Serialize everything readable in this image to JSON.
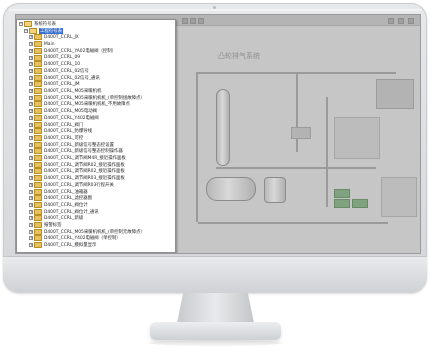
{
  "screen": {
    "background_app": {
      "diagram_title": "凸轮排气系统"
    },
    "tree": {
      "items": [
        {
          "label": "系统符号表",
          "level": 0,
          "expander": "−",
          "open": true
        },
        {
          "label": "工程符号表",
          "level": 1,
          "expander": "−",
          "open": true,
          "selected": true
        },
        {
          "label": "D400T_CCRL_JX",
          "level": 2,
          "expander": "+"
        },
        {
          "label": "Main",
          "level": 2,
          "expander": "+"
        },
        {
          "label": "D400T_CCRL_YA02电磁阀（控制）",
          "level": 2,
          "expander": "+"
        },
        {
          "label": "D400T_CCRL_09",
          "level": 2,
          "expander": "+"
        },
        {
          "label": "D400T_CCRL_10",
          "level": 2,
          "expander": "+"
        },
        {
          "label": "D400T_CCRL_02信号",
          "level": 2,
          "expander": "+"
        },
        {
          "label": "D400T_CCRL_02信号_通讯",
          "level": 2,
          "expander": "+"
        },
        {
          "label": "D400T_CCRL_JM",
          "level": 2,
          "expander": "+"
        },
        {
          "label": "D400T_CCRL_M05采暖机机",
          "level": 2,
          "expander": "+"
        },
        {
          "label": "D400T_CCRL_M05采暖机机机_(单控制组故障点）",
          "level": 2,
          "expander": "+"
        },
        {
          "label": "D400T_CCRL_M05采暖机机机_不用故障点",
          "level": 2,
          "expander": "+"
        },
        {
          "label": "D400T_CCRL_M05电动阀",
          "level": 2,
          "expander": "+"
        },
        {
          "label": "D400T_CCRL_Y402电磁阀",
          "level": 2,
          "expander": "+"
        },
        {
          "label": "D400T_CCRL_阀门",
          "level": 2,
          "expander": "+"
        },
        {
          "label": "D400T_CCRL_防爆导线",
          "level": 2,
          "expander": "+"
        },
        {
          "label": "D400T_CCRL_可控",
          "level": 2,
          "expander": "+"
        },
        {
          "label": "D400T_CCRL_新级信号整态控设置",
          "level": 2,
          "expander": "+"
        },
        {
          "label": "D400T_CCRL_新级信号整态控制操作器",
          "level": 2,
          "expander": "+"
        },
        {
          "label": "D400T_CCRL_调节阀M4R_接近操作面板",
          "level": 2,
          "expander": "+"
        },
        {
          "label": "D400T_CCRL_调节阀R02_接近操作面板",
          "level": 2,
          "expander": "+"
        },
        {
          "label": "D400T_CCRL_调节阀R02_接近操作面板",
          "level": 2,
          "expander": "+"
        },
        {
          "label": "D400T_CCRL_调节阀R03_接近操作面板",
          "level": 2,
          "expander": "+"
        },
        {
          "label": "D400T_CCRL_调节阀R03行程开关",
          "level": 2,
          "expander": "+"
        },
        {
          "label": "D400T_CCRL_油箱器",
          "level": 2,
          "expander": "+"
        },
        {
          "label": "D400T_CCRL_滤控器图",
          "level": 2,
          "expander": "+"
        },
        {
          "label": "D400T_CCRL_阀位计",
          "level": 2,
          "expander": "+"
        },
        {
          "label": "D400T_CCRL_阀位计_通讯",
          "level": 2,
          "expander": "+"
        },
        {
          "label": "D400T_CCRL_新级",
          "level": 2,
          "expander": "+"
        },
        {
          "label": "报警标签",
          "level": 2,
          "expander": "+"
        },
        {
          "label": "D400T_CCRL_M05采暖机机机_(单控制元故障点）",
          "level": 2,
          "expander": "+"
        },
        {
          "label": "D400T_CCRL_Y402电磁阀（单控制）",
          "level": 2,
          "expander": "+"
        },
        {
          "label": "D400T_CCRL_模拟量显示",
          "level": 2,
          "expander": "+"
        }
      ]
    }
  }
}
